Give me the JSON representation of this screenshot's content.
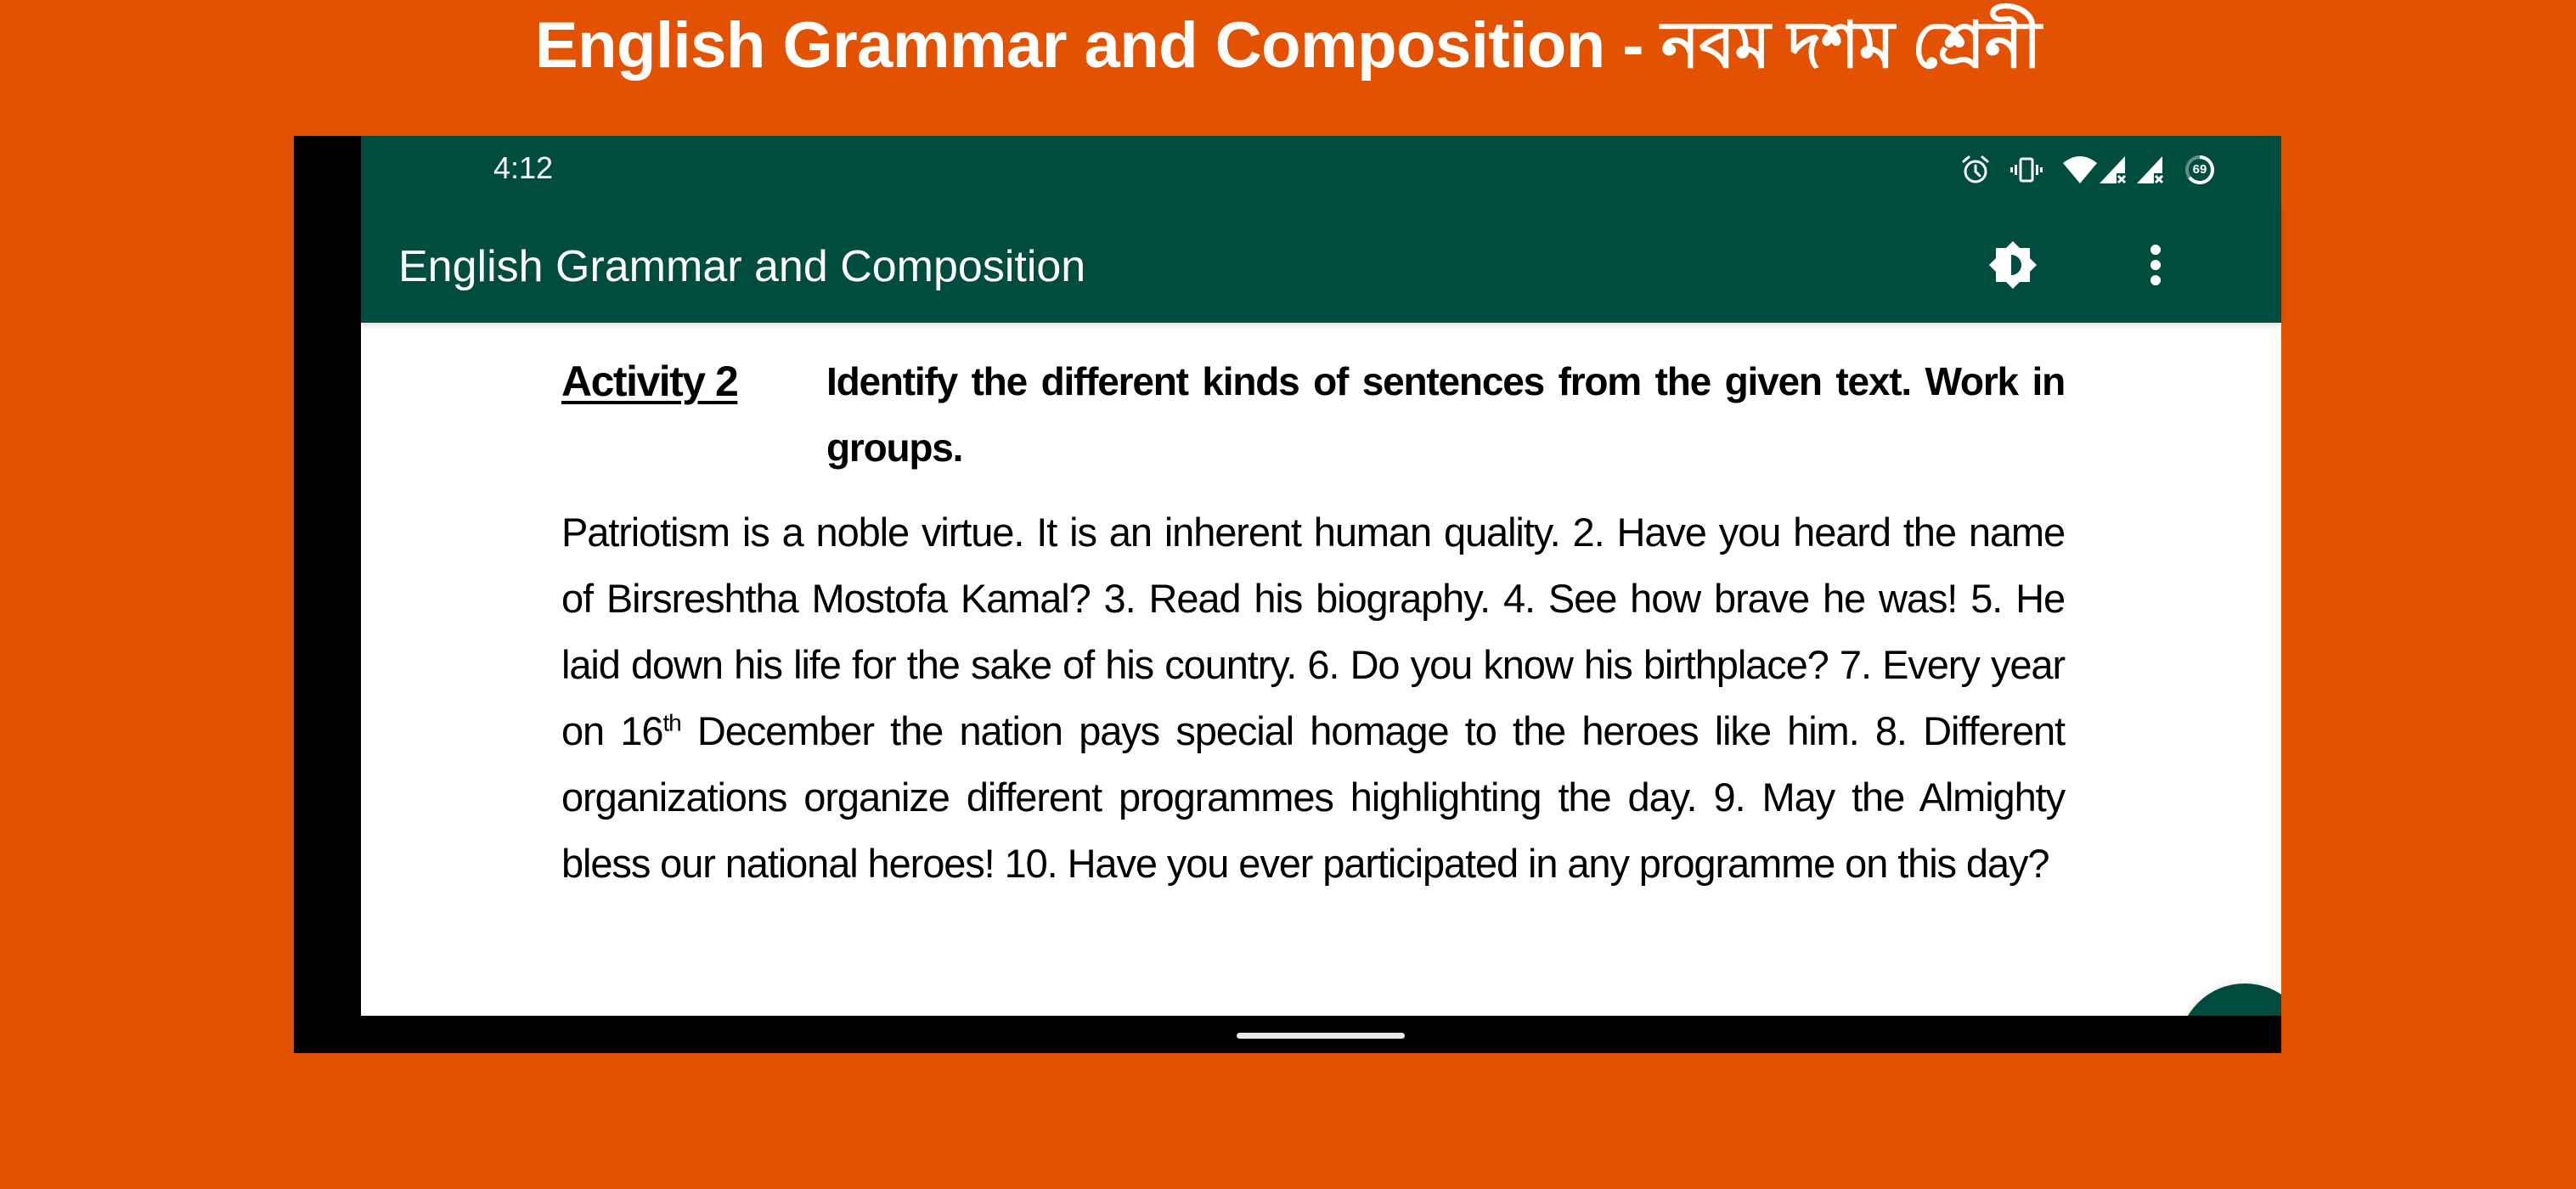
{
  "banner": {
    "title": "English Grammar and Composition - নবম দশম শ্রেনী"
  },
  "colors": {
    "background": "#E35200",
    "primary": "#004D40",
    "content_bg": "#FFFFFF",
    "bezel": "#000000"
  },
  "status_bar": {
    "time": "4:12",
    "icons": [
      "alarm-icon",
      "vibrate-icon",
      "wifi-icon",
      "signal-no-service-icon",
      "signal-no-service-icon",
      "battery-saver-icon"
    ],
    "battery_level": "69"
  },
  "app_bar": {
    "title": "English Grammar and Composition",
    "actions": [
      "brightness-icon",
      "more-vert-icon"
    ]
  },
  "document": {
    "activity_label": "Activity 2",
    "activity_instruction": "Identify the different kinds of sentences from the given text. Work in groups.",
    "passage_before_sup": "Patriotism is a noble virtue. It is an inherent human quality. 2. Have you heard the name of Birsreshtha Mostofa Kamal? 3. Read his biography. 4. See how brave he was! 5. He laid down his life for the sake of his country. 6.  Do you know his birthplace? 7. Every year on 16",
    "passage_sup": "th",
    "passage_after_sup": " December the nation pays special homage to the heroes like him.  8. Different organizations organize different programmes highlighting the day. 9. May the Almighty bless our national heroes! 10. Have you ever participated in any programme on this day?"
  },
  "fab": {
    "icon": "chevron-up-icon"
  }
}
